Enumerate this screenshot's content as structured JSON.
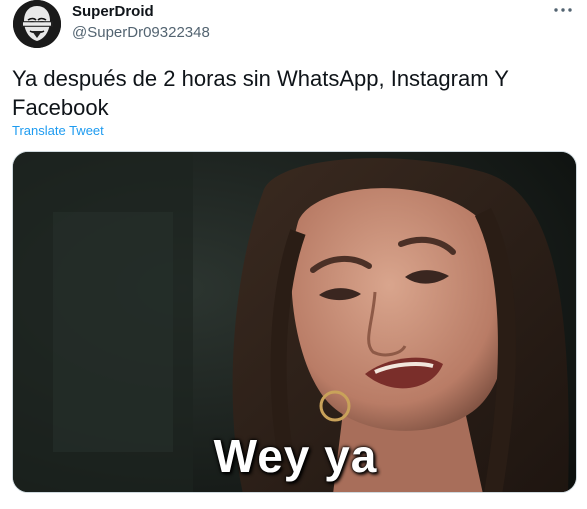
{
  "tweet": {
    "author": {
      "name": "SuperDroid",
      "handle": "@SuperDr09322348",
      "avatar_icon": "anonymous-mask-icon"
    },
    "text": "Ya después de 2 horas sin WhatsApp, Instagram Y Facebook",
    "translate_label": "Translate Tweet",
    "more_icon": "more-dots-icon",
    "media": {
      "caption": "Wey ya"
    }
  },
  "colors": {
    "link": "#1d9bf0",
    "secondary_text": "#536471",
    "primary_text": "#0f1419",
    "border": "#cfd9de"
  }
}
